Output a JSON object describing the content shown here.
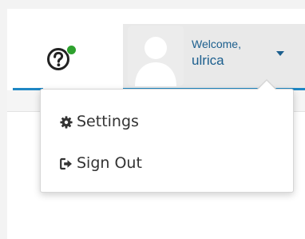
{
  "header": {
    "help_icon": "question-circle-icon",
    "status_color": "#2ea12e",
    "accent_color": "#1f87c4"
  },
  "user_menu": {
    "welcome": "Welcome,",
    "username": "ulrica",
    "avatar_icon": "default-user-avatar-icon",
    "caret_icon": "caret-down-icon"
  },
  "dropdown": {
    "items": [
      {
        "label": "Settings",
        "icon": "gear-icon"
      },
      {
        "label": "Sign Out",
        "icon": "sign-out-icon"
      }
    ]
  }
}
